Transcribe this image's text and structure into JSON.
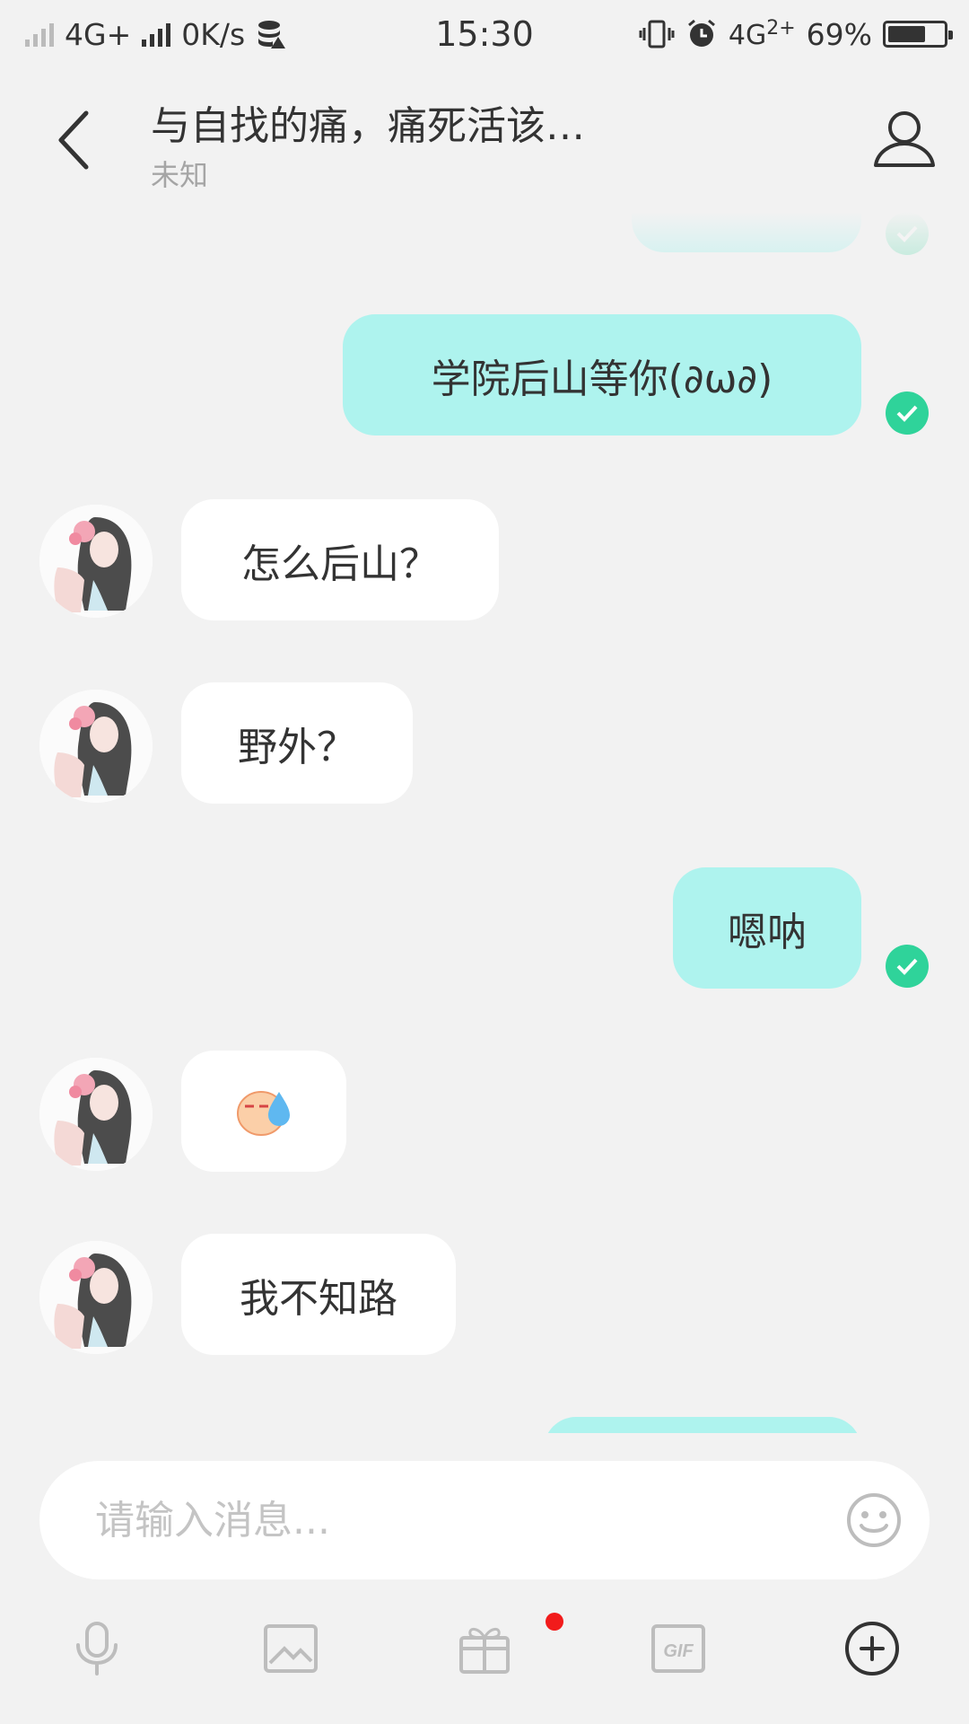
{
  "status_bar": {
    "network_1": "4G+",
    "speed": "0K/s",
    "time": "15:30",
    "network_2": "4G",
    "network_2_sup": "2+",
    "battery": "69%",
    "battery_level": 0.69
  },
  "header": {
    "title": "与自找的痛，痛死活该…",
    "subtitle": "未知"
  },
  "messages": [
    {
      "side": "out",
      "text": "学院后山等你(∂ω∂)",
      "status": "sent"
    },
    {
      "side": "in",
      "text": "怎么后山？"
    },
    {
      "side": "in",
      "text": "野外？"
    },
    {
      "side": "out",
      "text": "嗯呐",
      "status": "sent"
    },
    {
      "side": "in",
      "text": "",
      "emoji": "sweat-emoji-icon"
    },
    {
      "side": "in",
      "text": "我不知路"
    }
  ],
  "composer": {
    "placeholder": "请输入消息..."
  },
  "toolbar": {
    "items": [
      "microphone-icon",
      "image-icon",
      "gift-icon",
      "gif-icon",
      "plus-circle-icon"
    ],
    "gif_label": "GIF"
  },
  "colors": {
    "background": "#f2f2f2",
    "outgoing_bubble": "#aef3ee",
    "incoming_bubble": "#ffffff",
    "check": "#2fd39a",
    "badge": "#f21b1b"
  }
}
